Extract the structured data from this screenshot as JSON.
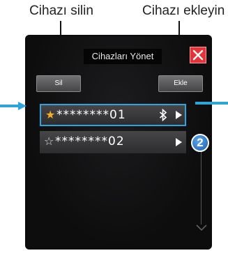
{
  "callouts": {
    "delete_label": "Cihazı silin",
    "add_label": "Cihazı ekleyin"
  },
  "dialog": {
    "title": "Cihazları Yönet",
    "close_icon": "close-icon",
    "delete_label": "Sil",
    "add_label": "Ekle"
  },
  "devices": [
    {
      "star": "★",
      "name": "********01",
      "selected": true,
      "favorite": true,
      "icons": [
        "bluetooth-icon",
        "play-icon"
      ]
    },
    {
      "star": "☆",
      "name": "********02",
      "selected": false,
      "favorite": false,
      "icons": [
        "play-icon"
      ]
    }
  ],
  "step_badge": "2",
  "colors": {
    "highlight": "#2fa3dc",
    "close": "#e8323a",
    "favorite_star": "#f2b027",
    "badge": "#2a76c8"
  }
}
